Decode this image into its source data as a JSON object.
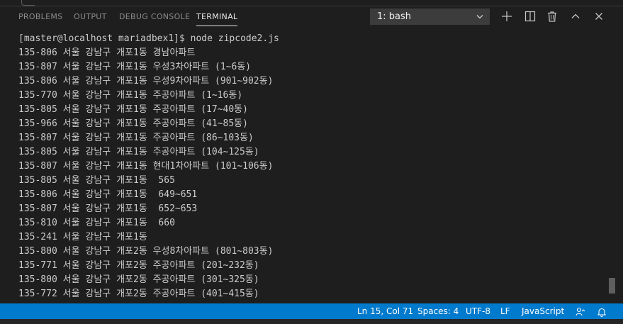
{
  "panel": {
    "tabs": [
      {
        "label": "PROBLEMS"
      },
      {
        "label": "OUTPUT"
      },
      {
        "label": "DEBUG CONSOLE"
      },
      {
        "label": "TERMINAL",
        "active": true
      }
    ],
    "terminal_select": {
      "value": "1: bash"
    },
    "actions": [
      "plus-icon",
      "split-terminal-icon",
      "trash-icon",
      "maximize-chevron-up-icon",
      "close-icon"
    ]
  },
  "terminal": {
    "lines": [
      "[master@localhost mariadbex1]$ node zipcode2.js",
      "135-806 서울 강남구 개포1동 경남아파트",
      "135-807 서울 강남구 개포1동 우성3차아파트 (1∼6동)",
      "135-806 서울 강남구 개포1동 우성9차아파트 (901∼902동)",
      "135-770 서울 강남구 개포1동 주공아파트 (1∼16동)",
      "135-805 서울 강남구 개포1동 주공아파트 (17∼40동)",
      "135-966 서울 강남구 개포1동 주공아파트 (41∼85동)",
      "135-807 서울 강남구 개포1동 주공아파트 (86∼103동)",
      "135-805 서울 강남구 개포1동 주공아파트 (104∼125동)",
      "135-807 서울 강남구 개포1동 현대1차아파트 (101∼106동)",
      "135-805 서울 강남구 개포1동  565",
      "135-806 서울 강남구 개포1동  649∼651",
      "135-807 서울 강남구 개포1동  652∼653",
      "135-810 서울 강남구 개포1동  660",
      "135-241 서울 강남구 개포1동",
      "135-800 서울 강남구 개포2동 우성8차아파트 (801∼803동)",
      "135-771 서울 강남구 개포2동 주공아파트 (201∼232동)",
      "135-800 서울 강남구 개포2동 주공아파트 (301∼325동)",
      "135-772 서울 강남구 개포2동 주공아파트 (401∼415동)"
    ]
  },
  "statusbar": {
    "position": "Ln 15, Col 71",
    "spaces": "Spaces: 4",
    "encoding": "UTF-8",
    "eol": "LF",
    "language": "JavaScript",
    "feedback_icon": "feedback-person-icon",
    "bell_icon": "bell-icon"
  },
  "colors": {
    "panel_bg": "#1e1e1e",
    "status_bg": "#007acc",
    "tab_active": "#e7e7e7",
    "tab_inactive": "#8b8b8b",
    "terminal_fg": "#cccccc"
  }
}
